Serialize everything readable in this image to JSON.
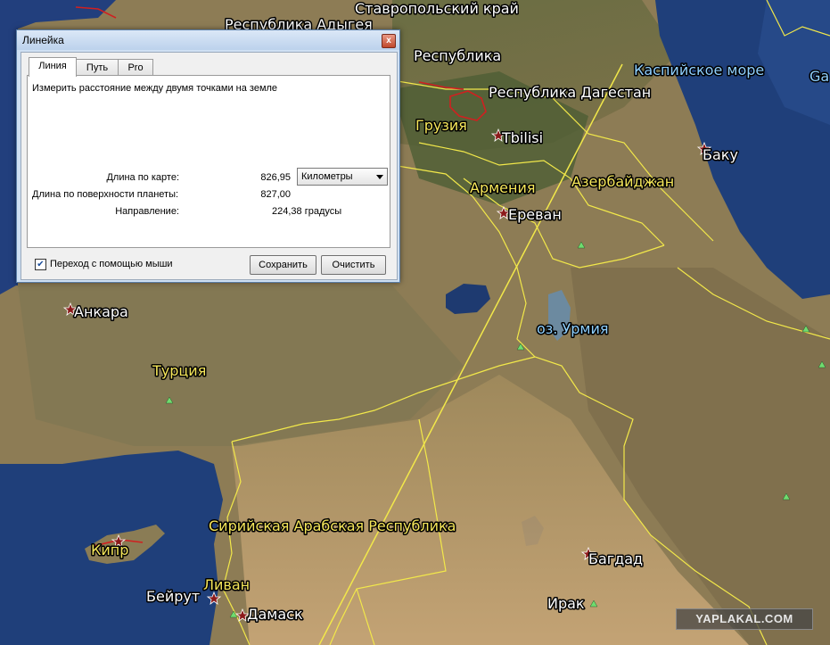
{
  "dialog": {
    "title": "Линейка",
    "close_glyph": "x",
    "tabs": [
      {
        "label": "Линия",
        "active": true
      },
      {
        "label": "Путь",
        "active": false
      },
      {
        "label": "Pro",
        "active": false
      }
    ],
    "instruction": "Измерить расстояние между двумя точками на земле",
    "map_length_label": "Длина по карте:",
    "map_length_value": "826,95",
    "units_selected": "Километры",
    "surface_length_label": "Длина по поверхности планеты:",
    "surface_length_value": "827,00",
    "direction_label": "Направление:",
    "direction_value": "224,38 градусы",
    "mouse_nav_label": "Переход с помощью мыши",
    "mouse_nav_checked": true,
    "save_label": "Сохранить",
    "clear_label": "Очистить"
  },
  "map": {
    "labels": {
      "stavropol": "Ставропольский край",
      "adygea": "Республика Адыгея",
      "republika": "Республика",
      "dagestan": "Республика Дагестан",
      "caspian": "Каспийское море",
      "ga": "Ga",
      "georgia": "Грузия",
      "tbilisi": "Tbilisi",
      "baku": "Баку",
      "armenia": "Армения",
      "azerbaijan": "Азербайджан",
      "yerevan": "Ереван",
      "ankara": "Анкара",
      "urmia": "оз. Урмия",
      "turkey": "Турция",
      "syria": "Сирийская Арабская Республика",
      "cyprus": "Кипр",
      "baghdad": "Багдад",
      "lebanon": "Ливан",
      "beirut": "Бейрут",
      "damascus": "Дамаск",
      "iraq": "Ирак"
    },
    "watermark": "YAPLAKAL.COM",
    "colors": {
      "sea": "#1f3f7a",
      "land": "#8c7a52",
      "border": "#f2e84a",
      "ruler_line": "#f2e84a",
      "region_border": "#d02020"
    }
  }
}
